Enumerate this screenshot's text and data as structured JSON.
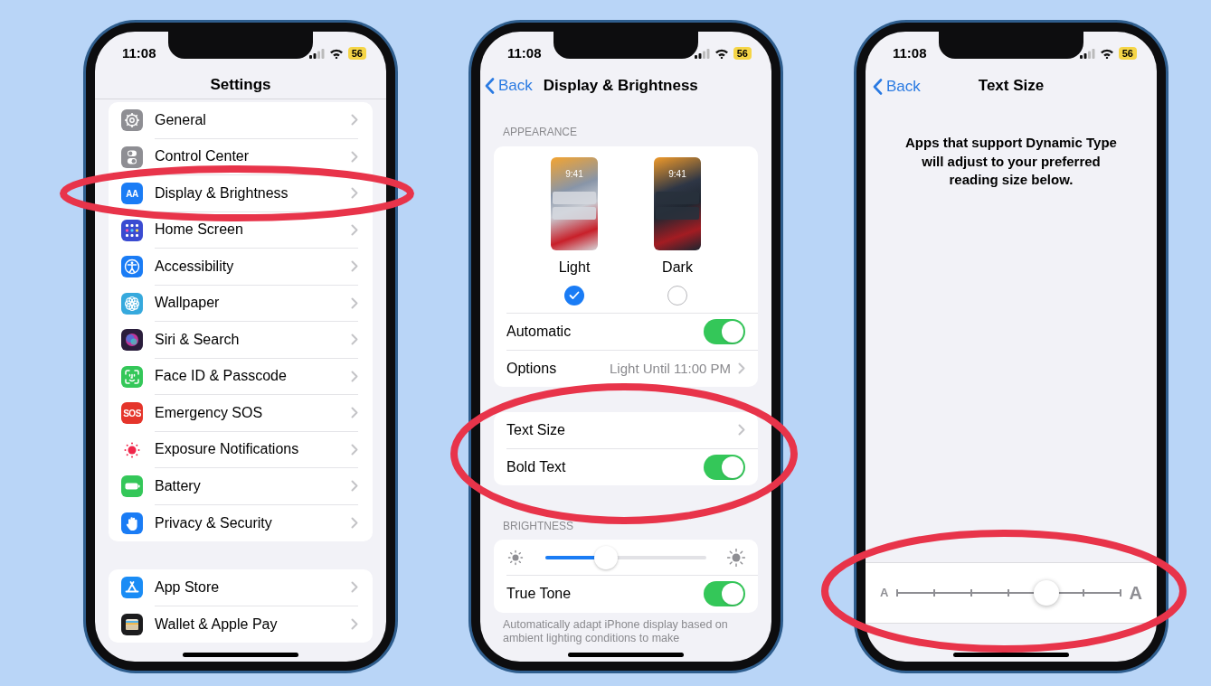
{
  "phones": [
    {
      "kind": "settings",
      "time": "11:08",
      "battery": "56",
      "title": "Settings",
      "groups": [
        {
          "items": [
            {
              "label": "General",
              "color": "#8e8e93"
            },
            {
              "label": "Control Center",
              "color": "#8e8e93"
            },
            {
              "label": "Display & Brightness",
              "color": "#1a7cf5",
              "icon_text": "AA"
            },
            {
              "label": "Home Screen",
              "color": "#3a4bd1"
            },
            {
              "label": "Accessibility",
              "color": "#1a7cf5"
            },
            {
              "label": "Wallpaper",
              "color": "#36a9dd"
            },
            {
              "label": "Siri & Search",
              "color": "#2a1d3c"
            },
            {
              "label": "Face ID & Passcode",
              "color": "#34c759"
            },
            {
              "label": "Emergency SOS",
              "color": "#e5352b",
              "icon_text": "SOS"
            },
            {
              "label": "Exposure Notifications",
              "color": "#ffffff"
            },
            {
              "label": "Battery",
              "color": "#34c759"
            },
            {
              "label": "Privacy & Security",
              "color": "#1a7cf5"
            }
          ]
        },
        {
          "items": [
            {
              "label": "App Store",
              "color": "#1a8cf5"
            },
            {
              "label": "Wallet & Apple Pay",
              "color": "#1c1c1e"
            }
          ]
        }
      ]
    },
    {
      "kind": "display",
      "time": "11:08",
      "battery": "56",
      "back": "Back",
      "title": "Display & Brightness",
      "appearance_header": "APPEARANCE",
      "modes": [
        {
          "label": "Light",
          "preview_time": "9:41",
          "selected": true
        },
        {
          "label": "Dark",
          "preview_time": "9:41",
          "selected": false
        }
      ],
      "rows": [
        {
          "kind": "toggle",
          "label": "Automatic",
          "on": true
        },
        {
          "kind": "link",
          "label": "Options",
          "value": "Light Until 11:00 PM"
        }
      ],
      "text_rows": [
        {
          "kind": "link",
          "label": "Text Size"
        },
        {
          "kind": "toggle",
          "label": "Bold Text",
          "on": true
        }
      ],
      "brightness_header": "BRIGHTNESS",
      "brightness": {
        "level": 0.375
      },
      "brightness_rows": [
        {
          "kind": "toggle",
          "label": "True Tone",
          "on": true
        }
      ],
      "footnote": "Automatically adapt iPhone display based on ambient lighting conditions to make"
    },
    {
      "kind": "text_size",
      "time": "11:08",
      "battery": "56",
      "back": "Back",
      "title": "Text Size",
      "description": "Apps that support Dynamic Type will adjust to your preferred reading size below.",
      "slider": {
        "small_label": "A",
        "large_label": "A",
        "level": 0.667
      }
    }
  ]
}
